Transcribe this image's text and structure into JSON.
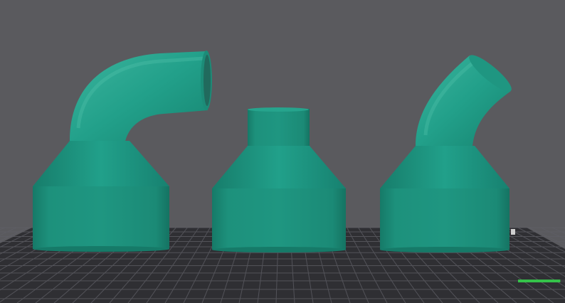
{
  "viewport": {
    "background_color": "#5a5a5e",
    "bed_color": "#2f2f33",
    "bed_grid_color": "#6a6a70",
    "model_color": "#1f9681",
    "model_shade_color": "#157362",
    "model_highlight_color": "#3bb39c",
    "progress_color": "#35c24a",
    "progress_fraction": 0.09
  },
  "models": [
    {
      "label": "",
      "shape": "90-degree-elbow-adapter"
    },
    {
      "label": "",
      "shape": "straight-adapter"
    },
    {
      "label": "",
      "shape": "45-degree-angled-adapter"
    }
  ]
}
